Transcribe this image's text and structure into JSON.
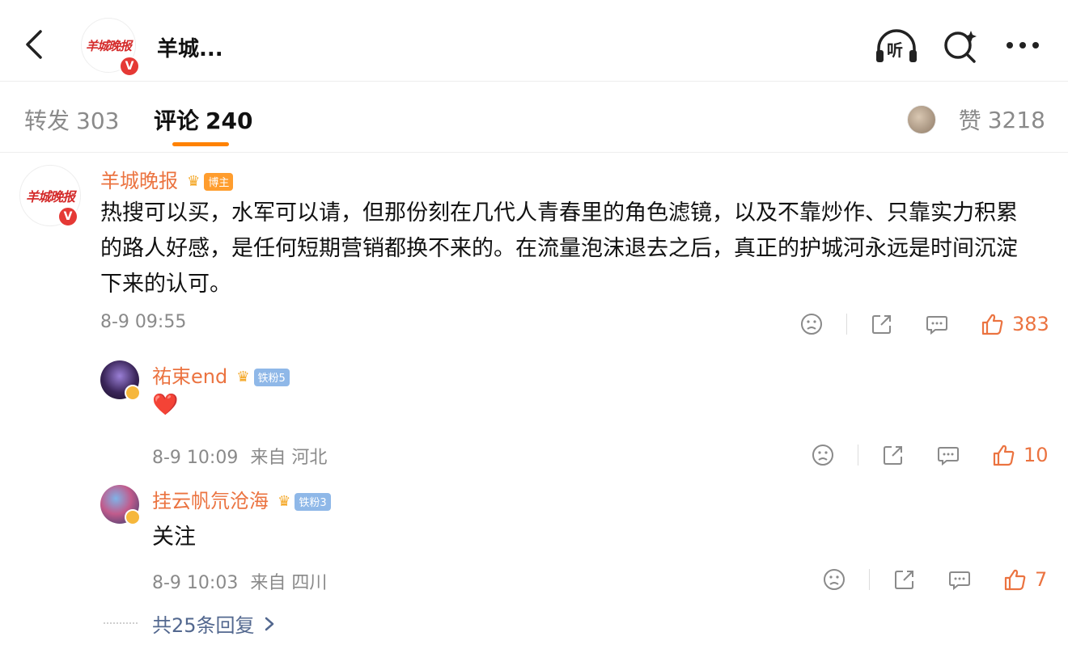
{
  "header": {
    "title": "羊城...",
    "logo_text": "羊城晚报",
    "listen_label": "听"
  },
  "tabs": {
    "repost_label": "转发",
    "repost_count": "303",
    "comment_label": "评论",
    "comment_count": "240",
    "like_label": "赞",
    "like_count": "3218"
  },
  "comment": {
    "username": "羊城晚报",
    "badge": "博主",
    "avatar_text": "羊城晚报",
    "text": "热搜可以买，水军可以请，但那份刻在几代人青春里的角色滤镜，以及不靠炒作、只靠实力积累的路人好感，是任何短期营销都换不来的。在流量泡沫退去之后，真正的护城河永远是时间沉淀下来的认可。",
    "time": "8-9 09:55",
    "likes": "383"
  },
  "replies": [
    {
      "username": "祐束end",
      "badge": "铁粉5",
      "text": "❤️",
      "time": "8-9 10:09",
      "location": "来自 河北",
      "likes": "10"
    },
    {
      "username": "挂云帆氘沧海",
      "badge": "铁粉3",
      "text": "关注",
      "time": "8-9 10:03",
      "location": "来自 四川",
      "likes": "7"
    }
  ],
  "more_replies": "共25条回复",
  "colors": {
    "accent": "#ff8200",
    "username": "#eb7340",
    "link": "#53688f",
    "muted": "#8a8a8a"
  }
}
